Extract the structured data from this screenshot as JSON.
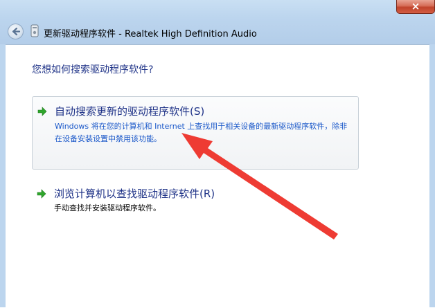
{
  "window": {
    "title": "更新驱动程序软件 - Realtek High Definition Audio",
    "close_glyph": "×"
  },
  "icons": {
    "back": "back-arrow-icon",
    "device": "device-icon",
    "option_arrow": "green-arrow-icon",
    "annotation": "red-arrow-icon"
  },
  "colors": {
    "heading": "#1e3287",
    "link_desc": "#1a58c9",
    "green_arrow": "#2fa62c",
    "annotation_red": "#ee3b33"
  },
  "main": {
    "question": "您想如何搜索驱动程序软件?",
    "options": [
      {
        "title": "自动搜索更新的驱动程序软件(S)",
        "description": "Windows 将在您的计算机和 Internet 上查找用于相关设备的最新驱动程序软件，除非在设备安装设置中禁用该功能。"
      },
      {
        "title": "浏览计算机以查找驱动程序软件(R)",
        "description": "手动查找并安装驱动程序软件。"
      }
    ]
  }
}
